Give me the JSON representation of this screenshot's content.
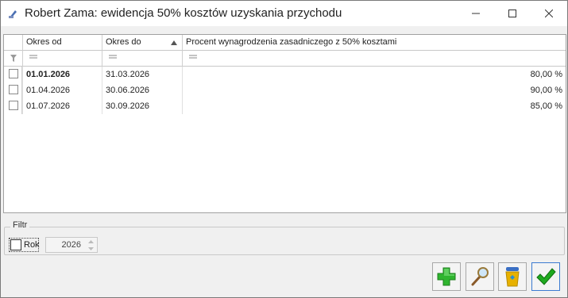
{
  "window": {
    "title": "Robert Zama: ewidencja 50% kosztów uzyskania przychodu",
    "icon": "app-icon",
    "controls": [
      "minimize-icon",
      "maximize-icon",
      "close-icon"
    ]
  },
  "grid": {
    "columns": [
      {
        "label": "Okres od"
      },
      {
        "label": "Okres do",
        "sort": "ascending"
      },
      {
        "label": "Procent wynagrodzenia zasadniczego z 50% kosztami"
      }
    ],
    "rows": [
      {
        "od": "01.01.2026",
        "do": "31.03.2026",
        "procent": "80,00 %",
        "selected": true
      },
      {
        "od": "01.04.2026",
        "do": "30.06.2026",
        "procent": "90,00 %",
        "selected": false
      },
      {
        "od": "01.07.2026",
        "do": "30.09.2026",
        "procent": "85,00 %",
        "selected": false
      }
    ]
  },
  "filter": {
    "group_label": "Filtr",
    "year_checkbox_label": "Rok",
    "year_checked": false,
    "year_value": "2026"
  },
  "actions": [
    "add-icon",
    "preview-icon",
    "delete-icon",
    "confirm-icon"
  ],
  "colors": {
    "add": "#2fb52f",
    "confirm": "#1faa1f",
    "delete": "#e7b100",
    "accent": "#3c7bd1"
  }
}
